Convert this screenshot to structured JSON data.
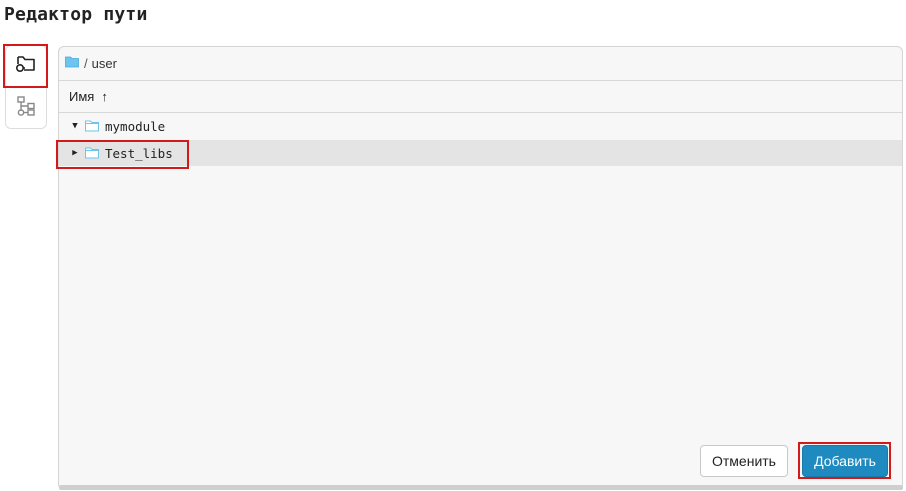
{
  "title": "Редактор пути",
  "sidebar": {
    "items": [
      {
        "icon": "folder-add-icon",
        "active": true
      },
      {
        "icon": "tree-structure-icon",
        "active": false
      }
    ]
  },
  "breadcrumb": {
    "separator": "/",
    "path": "user"
  },
  "table": {
    "column_label": "Имя",
    "sort_indicator": "↑"
  },
  "rows": [
    {
      "name": "mymodule",
      "expanded": true,
      "selected": false
    },
    {
      "name": "Test_libs",
      "expanded": false,
      "selected": true
    }
  ],
  "buttons": {
    "cancel": "Отменить",
    "add": "Добавить"
  },
  "colors": {
    "primary": "#1f8ac0",
    "highlight": "#d21a1a",
    "folder": "#6cc4ef"
  }
}
